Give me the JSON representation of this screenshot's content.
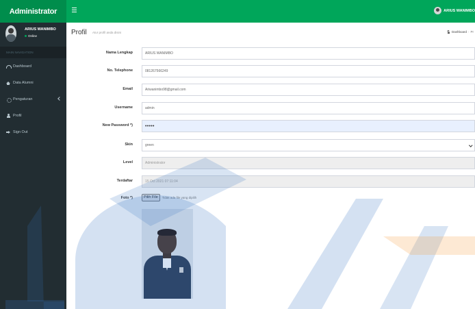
{
  "app": {
    "title": "Administrator"
  },
  "header": {
    "user_name": "ARIUS WANIMBO"
  },
  "sidebar": {
    "user_name": "ARIUS WANIMBO",
    "user_status": "Online",
    "nav_header": "MAIN NAVIGATION",
    "items": [
      {
        "label": "Dashboard",
        "icon": "dashboard-icon"
      },
      {
        "label": "Data Alumni",
        "icon": "graduation-cap-icon"
      },
      {
        "label": "Pengaturan",
        "icon": "gears-icon"
      },
      {
        "label": "Profil",
        "icon": "user-icon"
      },
      {
        "label": "Sign Out",
        "icon": "sign-out-icon"
      }
    ]
  },
  "page": {
    "title": "Profil",
    "subtitle": "Atur profil anda disini",
    "breadcrumb": {
      "home": "Dashboard",
      "current": "Pr"
    }
  },
  "form": {
    "nama_lengkap": {
      "label": "Nama Lengkap",
      "value": "ARIUS WANIMBO"
    },
    "telephone": {
      "label": "No. Telephone",
      "value": "081267566249"
    },
    "email": {
      "label": "Email",
      "value": "Ariwanimbo98@gmail.com"
    },
    "username": {
      "label": "Username",
      "value": "admin"
    },
    "password": {
      "label": "New Password *)",
      "value": "•••••"
    },
    "skin": {
      "label": "Skin",
      "value": "green"
    },
    "level": {
      "label": "Level",
      "value": "Administrator"
    },
    "terdaftar": {
      "label": "Terdaftar",
      "value": "15 Oct 2021 07:11:04"
    },
    "foto": {
      "label": "Foto *)",
      "button": "Pilih File",
      "status": "Tidak ada file yang dipilih"
    }
  },
  "colors": {
    "header_green": "#00a65a",
    "logo_green": "#008d4c",
    "sidebar_dark": "#222d32",
    "watermark_blue": "#3a78c3",
    "watermark_orange": "#f79a3c"
  }
}
